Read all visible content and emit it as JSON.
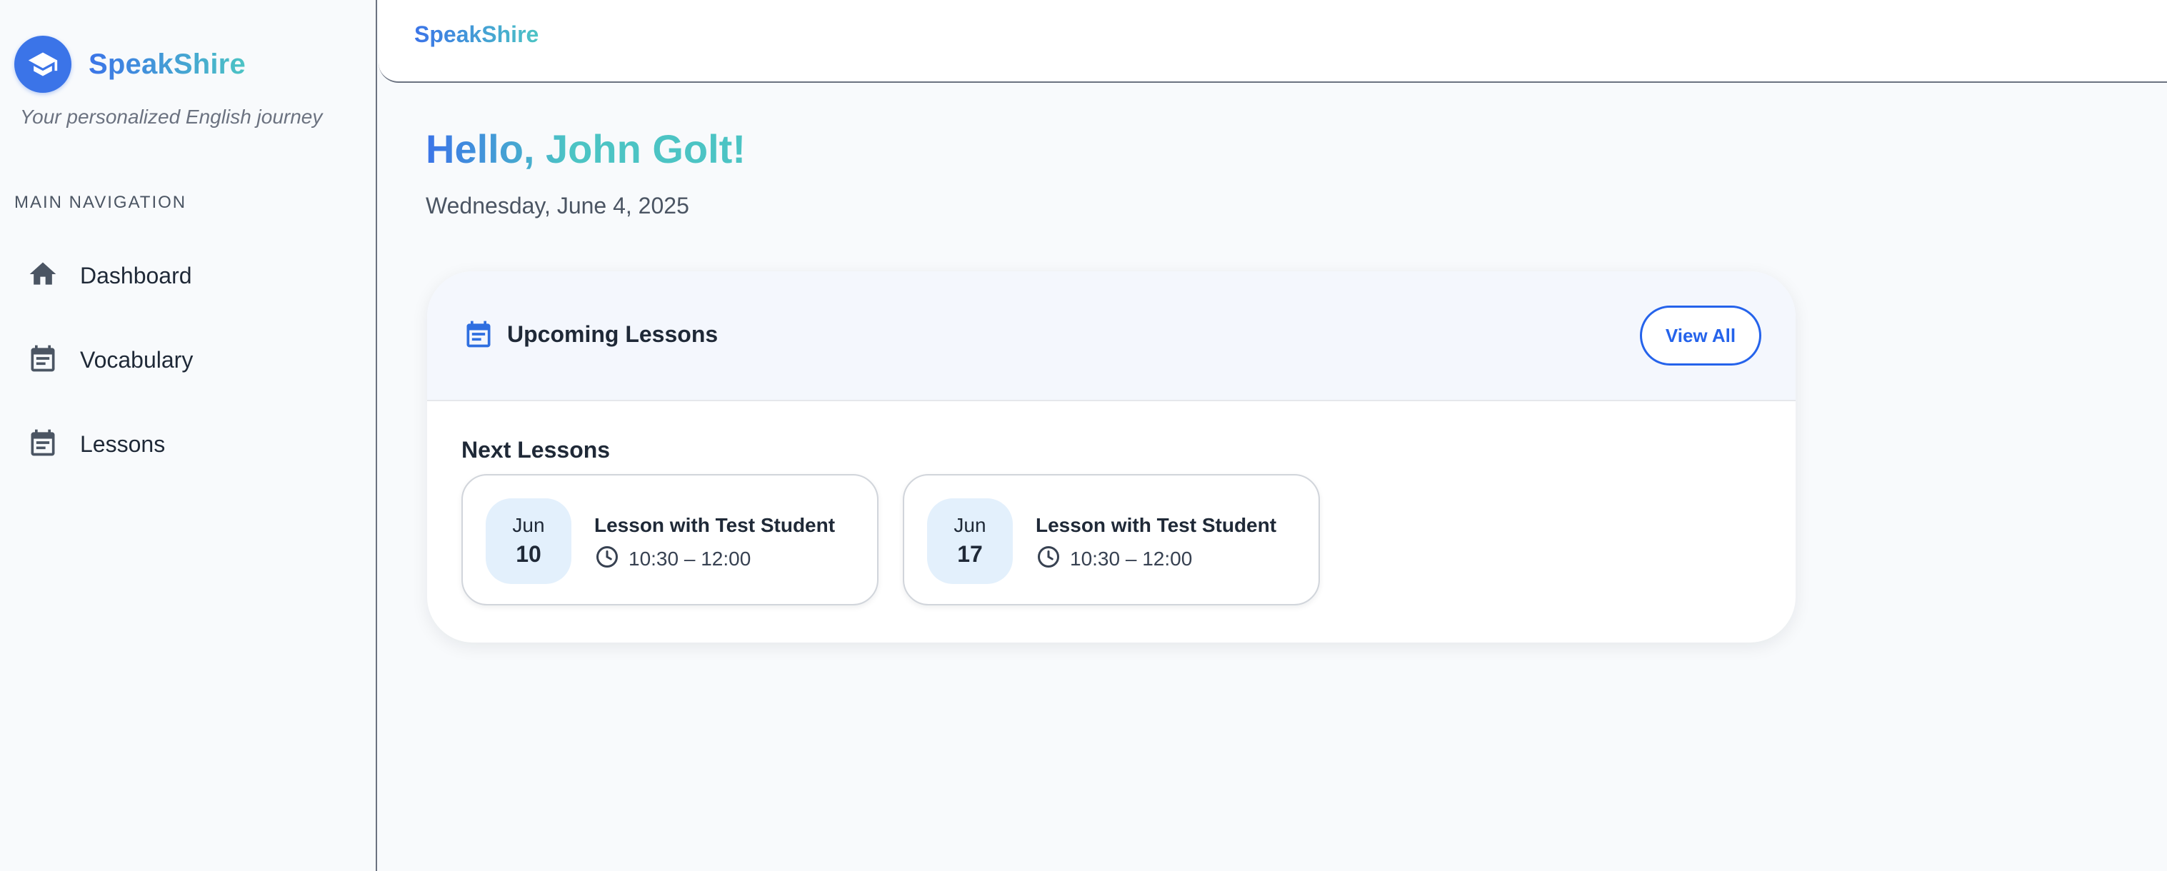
{
  "app": {
    "name": "SpeakShire",
    "tagline": "Your personalized English journey",
    "brand_color": "#3b74e8",
    "accent_color": "#4cc4c4"
  },
  "topbar": {
    "title": "SpeakShire"
  },
  "sidebar": {
    "nav_heading": "MAIN NAVIGATION",
    "items": [
      {
        "label": "Dashboard",
        "icon": "home-icon"
      },
      {
        "label": "Vocabulary",
        "icon": "calendar-icon"
      },
      {
        "label": "Lessons",
        "icon": "calendar-icon"
      }
    ]
  },
  "main": {
    "greeting": "Hello, John Golt!",
    "date": "Wednesday, June 4, 2025",
    "upcoming": {
      "title": "Upcoming Lessons",
      "icon": "calendar-icon",
      "view_all_label": "View All",
      "section_title": "Next Lessons",
      "lessons": [
        {
          "month": "Jun",
          "day": "10",
          "title": "Lesson with Test Student",
          "time": "10:30 – 12:00"
        },
        {
          "month": "Jun",
          "day": "17",
          "title": "Lesson with Test Student",
          "time": "10:30 – 12:00"
        }
      ]
    }
  }
}
